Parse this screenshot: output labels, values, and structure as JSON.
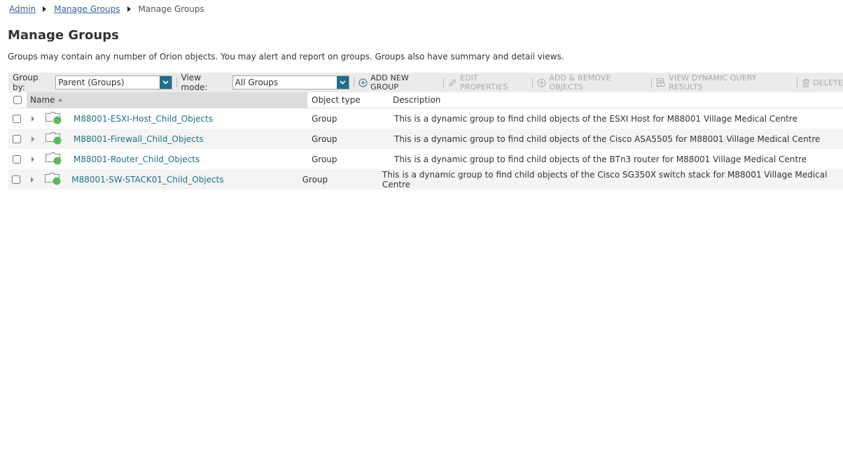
{
  "breadcrumb": {
    "items": [
      {
        "label": "Admin"
      },
      {
        "label": "Manage Groups"
      }
    ],
    "current": "Manage Groups"
  },
  "page": {
    "title": "Manage Groups",
    "description": "Groups may contain any number of Orion objects. You may alert and report on groups. Groups also have summary and detail views."
  },
  "toolbar": {
    "group_by_label": "Group by:",
    "group_by_value": "Parent (Groups)",
    "view_mode_label": "View mode:",
    "view_mode_value": "All Groups",
    "add_new_group": "ADD NEW GROUP",
    "edit_properties": "EDIT PROPERTIES",
    "add_remove_objects": "ADD & REMOVE OBJECTS",
    "view_dynamic_query_results": "VIEW DYNAMIC QUERY RESULTS",
    "delete": "DELETE"
  },
  "table": {
    "headers": {
      "name": "Name",
      "object_type": "Object type",
      "description": "Description"
    },
    "rows": [
      {
        "name": "M88001-ESXI-Host_Child_Objects",
        "type": "Group",
        "description": "This is a dynamic group to find child objects of the ESXI Host for M88001 Village Medical Centre"
      },
      {
        "name": "M88001-Firewall_Child_Objects",
        "type": "Group",
        "description": "This is a dynamic group to find child objects of the Cisco ASA5505 for M88001 Village Medical Centre"
      },
      {
        "name": "M88001-Router_Child_Objects",
        "type": "Group",
        "description": "This is a dynamic group to find child objects of the BTn3 router for M88001 Village Medical Centre"
      },
      {
        "name": "M88001-SW-STACK01_Child_Objects",
        "type": "Group",
        "description": "This is a dynamic group to find child objects of the Cisco SG350X switch stack for M88001 Village Medical Centre"
      }
    ]
  },
  "colors": {
    "link": "#336699",
    "row_link": "#1f6f8b",
    "status_up": "#5cb85c",
    "toolbar_bg": "#ebebeb"
  },
  "icons": {
    "row_icon": "folder-icon",
    "status": "status-up-dot"
  }
}
